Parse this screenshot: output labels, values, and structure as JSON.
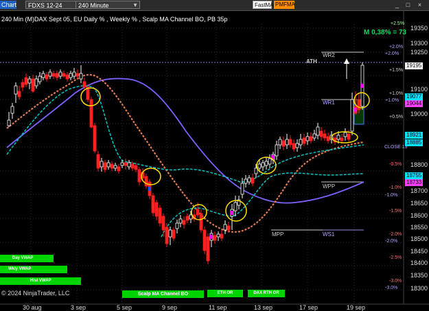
{
  "toolbar": {
    "chart_tab": "Chart",
    "instrument": "FDXS 12-24",
    "interval": "240 Minute",
    "fastma_label": "FastMA",
    "pmfma_label": "PMFMA",
    "minimize": "_",
    "restore": "□",
    "close": "×"
  },
  "chart": {
    "title": "240 Min (M)DAX Sept 05, EU Daily % , Weekly % , Scalp MA Channel BO, PB 35p",
    "m_value": "M 0,38% = 73",
    "copyright": "© 2024 NinjaTrader, LLC",
    "ath_label": "ATH",
    "levels": {
      "wr2": "WR2",
      "wr1": "WR1",
      "wpp": "WPP",
      "ws1": "WS1",
      "mpp": "MPP",
      "close": "CLOSE 13"
    }
  },
  "price_axis": {
    "labels": [
      "19350",
      "19300",
      "19250",
      "19195",
      "19100",
      "19077",
      "19044",
      "19000",
      "18921",
      "18885",
      "18800",
      "18755",
      "18733",
      "18700",
      "18650",
      "18600",
      "18550",
      "18500",
      "18450",
      "18400",
      "18350",
      "18300"
    ],
    "highlights": {
      "current": "19195",
      "cyan": "19077",
      "magenta": "19044",
      "cyan2": "18921",
      "cyan3": "18885",
      "cyan4": "18755",
      "magenta2": "18733"
    }
  },
  "pct_labels": {
    "p25": "+2.5%",
    "p2": "+2.0%",
    "p2b": "+2.0%",
    "p15": "+1.5%",
    "p1": "+1.0%",
    "p1b": "+1.0%",
    "p05": "+0.5%",
    "m05": "-0.5%",
    "m1": "-1.0%",
    "m1b": "-1.0%",
    "m15": "-1.5%",
    "m2": "-2.0%",
    "m2b": "-2.0%",
    "m25": "-2.5%",
    "m3": "-3.0%",
    "m3b": "-3.0%"
  },
  "time_axis": [
    "30 aug",
    "3 sep",
    "5 sep",
    "9 sep",
    "11 sep",
    "13 sep",
    "17 sep",
    "19 sep"
  ],
  "buttons": {
    "day_vwap": "Day VWAP",
    "wkly_vwap": "Wkly VWAP",
    "hist_vwap": "Hist VWAP",
    "scalp": "Scalp MA Channel BO",
    "eth_or": "ETH OR",
    "dax_rth_or": "DAX RTH OR"
  },
  "colors": {
    "up": "#ffffff",
    "down": "#ff2020",
    "signal": "#ff00ff",
    "blue_mark": "#2050ff",
    "channel": "#00c8c8",
    "slow_ma": "#8060ff",
    "fast_ma": "#e07a50",
    "ellipse": "#ffe000",
    "button_green": "#00d400"
  }
}
